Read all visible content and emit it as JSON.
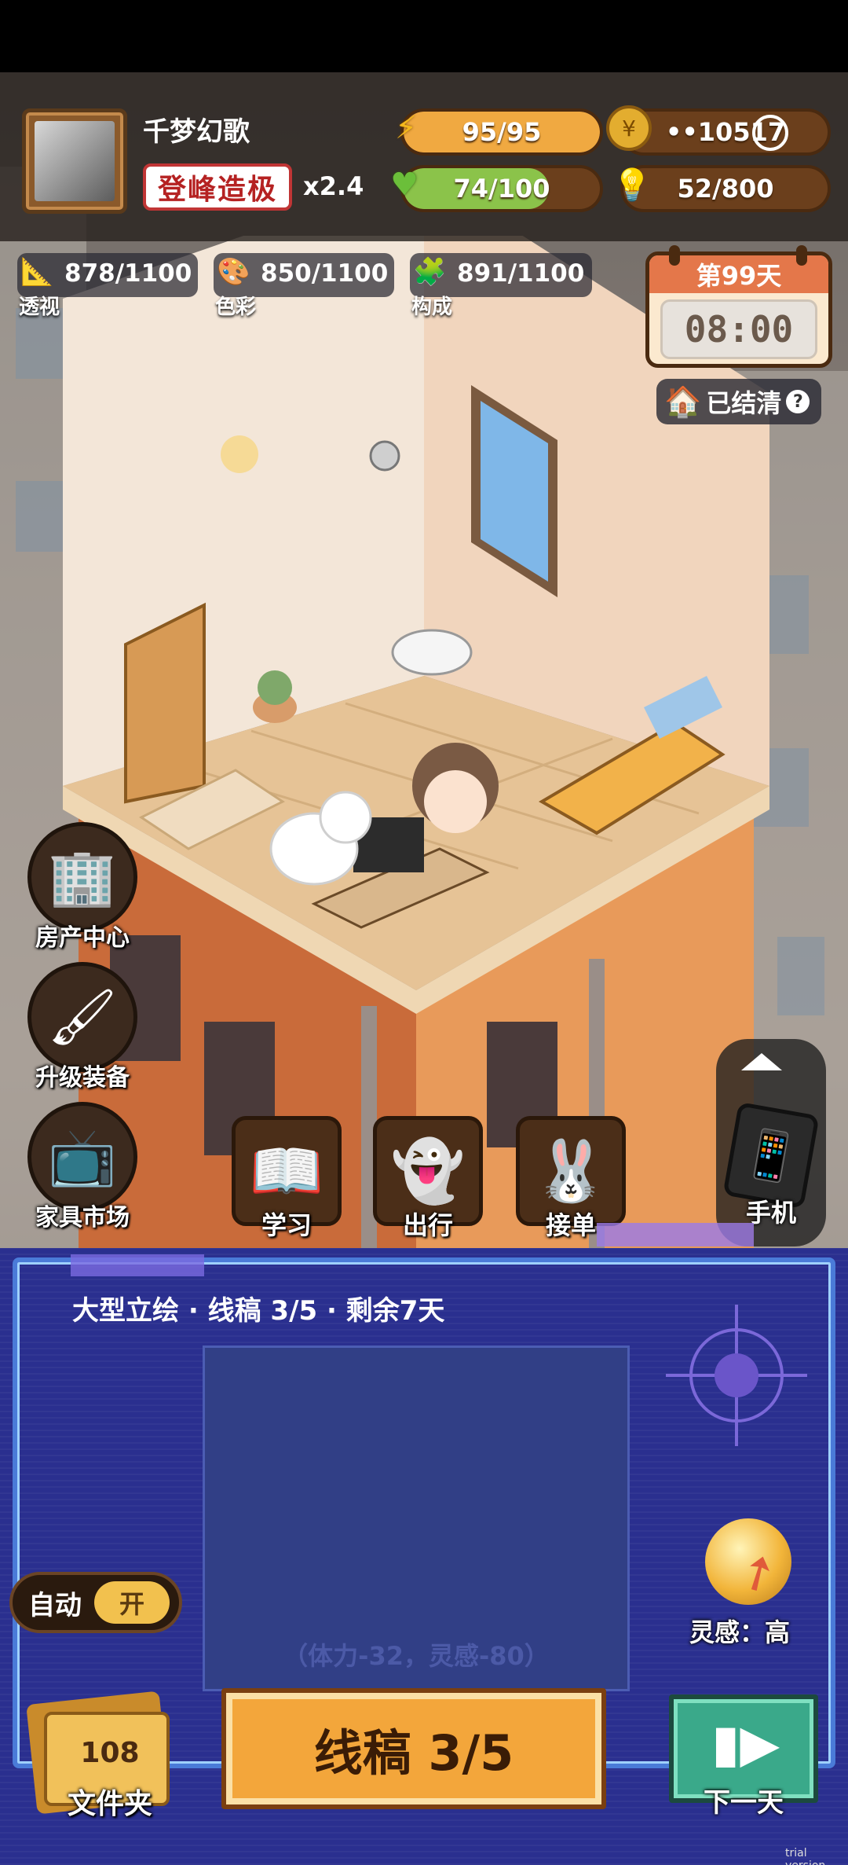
{
  "player": {
    "name": "千梦幻歌",
    "rank": "登峰造极",
    "multiplier": "x2.4"
  },
  "resources": {
    "energy": {
      "text": "95/95",
      "fill": 1.0,
      "icon": "lightning-icon"
    },
    "coins": {
      "text": "••10517",
      "icon": "coin-icon"
    },
    "health": {
      "text": "74/100",
      "fill": 0.74,
      "icon": "heart-icon"
    },
    "inspiration_points": {
      "text": "52/800",
      "icon": "lightbulb-icon"
    }
  },
  "skills": [
    {
      "value": "878/1100",
      "label": "透视",
      "icon": "ruler-icon"
    },
    {
      "value": "850/1100",
      "label": "色彩",
      "icon": "palette-icon"
    },
    {
      "value": "891/1100",
      "label": "构成",
      "icon": "composition-icon"
    }
  ],
  "calendar": {
    "day": "第99天",
    "time": "08:00",
    "status": "已结清"
  },
  "side_menu": [
    {
      "label": "房产中心",
      "icon": "building-icon"
    },
    {
      "label": "升级装备",
      "icon": "brush-pen-icon"
    },
    {
      "label": "家具市场",
      "icon": "furniture-icon"
    }
  ],
  "actions": [
    {
      "label": "学习",
      "icon": "book-icon"
    },
    {
      "label": "出行",
      "icon": "ghost-icon"
    },
    {
      "label": "接单",
      "icon": "rabbit-icon"
    }
  ],
  "phone": {
    "label": "手机"
  },
  "work_panel": {
    "job_title": "大型立绘 · 线稿 3/5 · 剩余7天",
    "cost": "（体力-32，灵感-80）",
    "auto_label": "自动",
    "auto_state": "开",
    "inspiration": "灵感：高",
    "folder_count": "108",
    "folder_label": "文件夹",
    "main_action": "线稿 3/5",
    "next_day": "下一天"
  },
  "watermark": "trial version",
  "colors": {
    "energy_bar": "#f0a941",
    "health_bar": "#8bc34a",
    "panel_bg": "#2a2f8f",
    "main_button": "#f3a63b",
    "next_button": "#3aa98a"
  }
}
